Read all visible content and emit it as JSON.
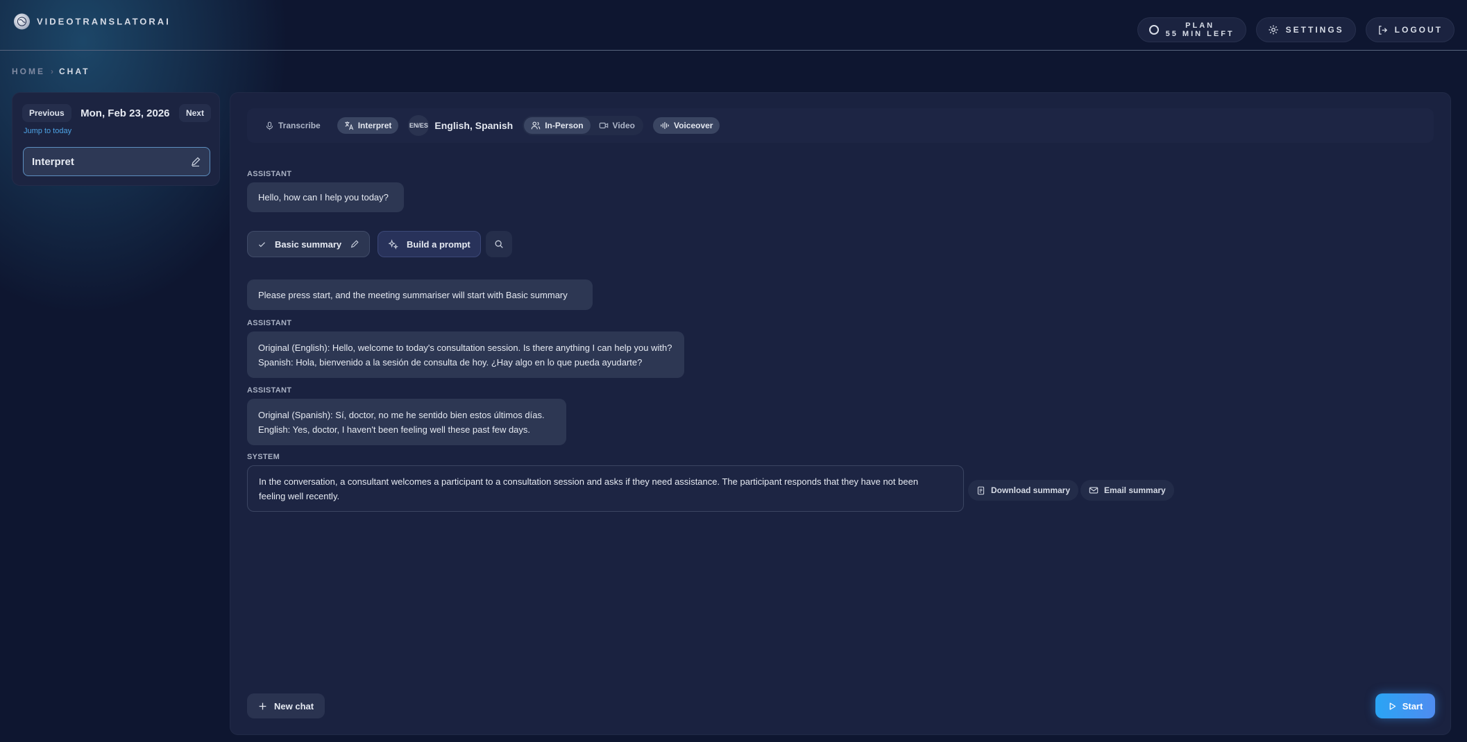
{
  "app": {
    "brand_name": "VIDEOTRANSLATORAI"
  },
  "header": {
    "plan_title": "PLAN",
    "plan_remaining": "55 MIN LEFT",
    "settings_label": "SETTINGS",
    "logout_label": "LOGOUT"
  },
  "breadcrumb": {
    "home": "HOME",
    "separator": "›",
    "current": "CHAT"
  },
  "sidebar": {
    "previous_label": "Previous",
    "date": "Mon, Feb 23, 2026",
    "next_label": "Next",
    "jump_label": "Jump to today",
    "chats": [
      {
        "title": "Interpret"
      }
    ]
  },
  "toolbar": {
    "transcribe_label": "Transcribe",
    "interpret_label": "Interpret",
    "lang_code": "EN/ES",
    "lang_label": "English, Spanish",
    "in_person_label": "In-Person",
    "video_label": "Video",
    "voiceover_label": "Voiceover"
  },
  "messages": [
    {
      "role": "ASSISTANT",
      "lines": [
        "Hello, how can I help you today?"
      ]
    },
    {
      "role": "",
      "lines": [
        "Please press start, and the meeting summariser will start with Basic summary"
      ]
    },
    {
      "role": "ASSISTANT",
      "lines": [
        "Original (English): Hello, welcome to today's consultation session. Is there anything I can help you with?",
        "Spanish: Hola, bienvenido a la sesión de consulta de hoy. ¿Hay algo en lo que pueda ayudarte?"
      ]
    },
    {
      "role": "ASSISTANT",
      "lines": [
        "Original (Spanish): Sí, doctor, no me he sentido bien estos últimos días.",
        "English: Yes, doctor, I haven't been feeling well these past few days."
      ]
    },
    {
      "role": "SYSTEM",
      "lines": [
        "In the conversation, a consultant welcomes a participant to a consultation session and asks if they need assistance. The participant responds that they have not been",
        "feeling well recently."
      ]
    }
  ],
  "prompt_chips": {
    "basic_summary_label": "Basic summary",
    "build_prompt_label": "Build a prompt"
  },
  "summary_actions": {
    "download_label": "Download summary",
    "email_label": "Email summary"
  },
  "footer": {
    "new_chat_label": "New chat",
    "start_label": "Start"
  },
  "colors": {
    "background": "#0e1630",
    "panel": "#1a2240",
    "accent": "#2aa4f4",
    "link": "#4ea4e6"
  }
}
